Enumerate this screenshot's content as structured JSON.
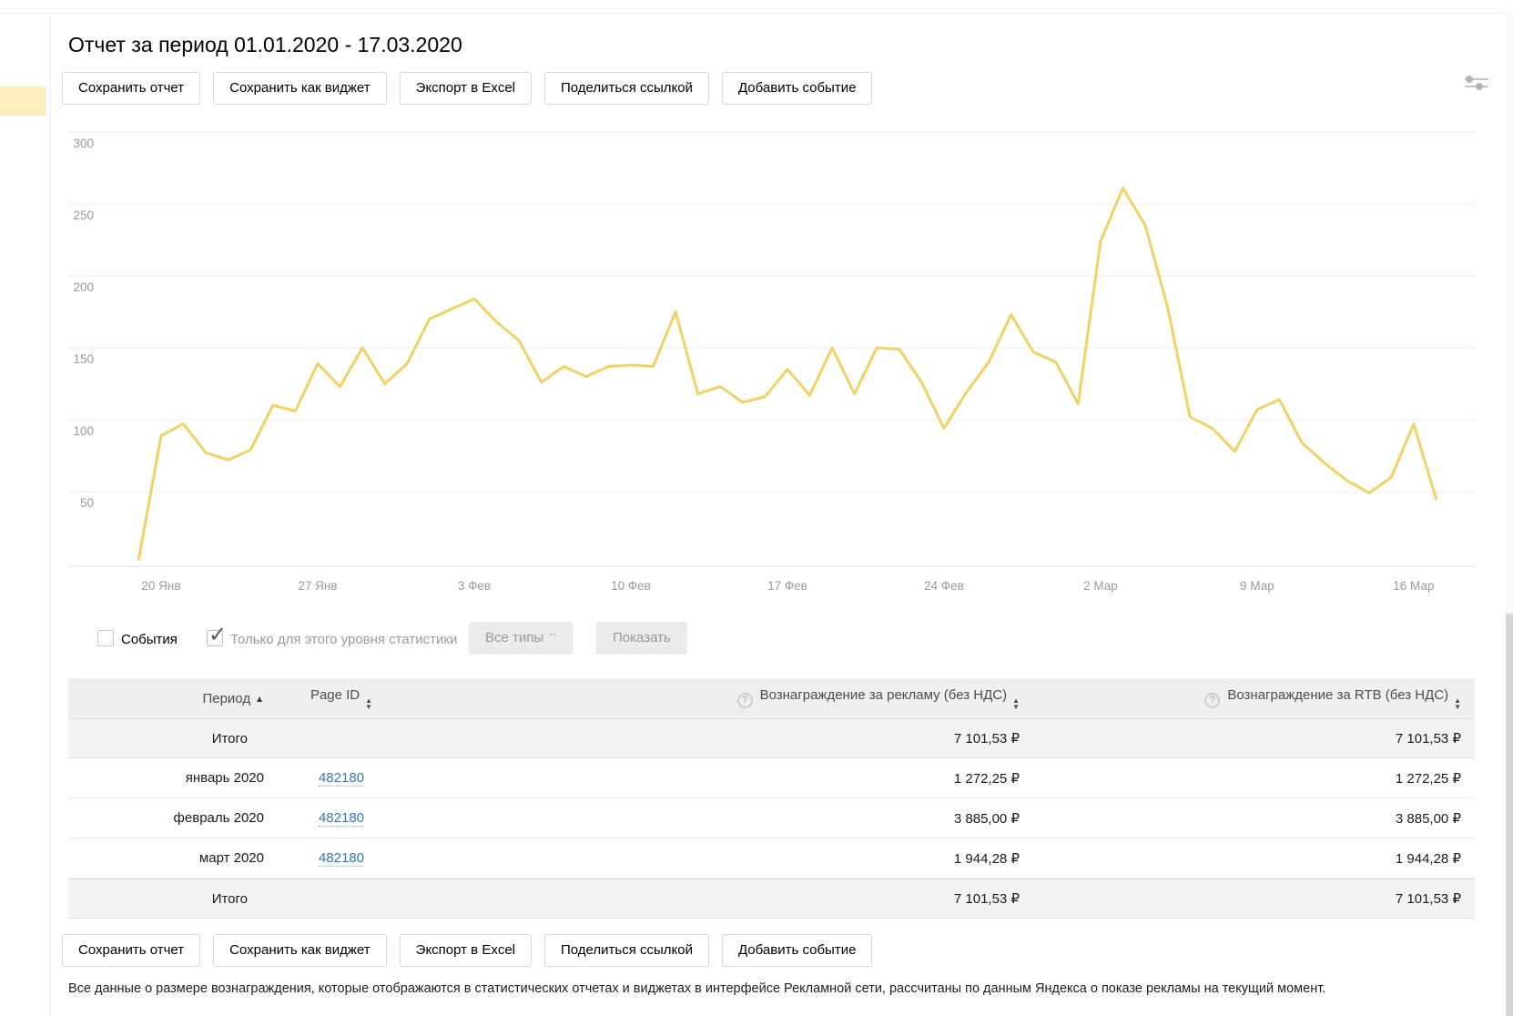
{
  "page": {
    "title": "Отчет за период 01.01.2020 - 17.03.2020"
  },
  "toolbar": {
    "buttons": [
      "Сохранить отчет",
      "Сохранить как виджет",
      "Экспорт в Excel",
      "Поделиться ссылкой",
      "Добавить событие"
    ]
  },
  "filters": {
    "events_label": "События",
    "events_checked": false,
    "level_label": "Только для этого уровня статистики",
    "level_checked": true,
    "type_select_label": "Все типы",
    "show_button_label": "Показать"
  },
  "chart_data": {
    "type": "line",
    "title": "",
    "xlabel": "",
    "ylabel": "",
    "ylim": [
      0,
      300
    ],
    "yticks": [
      50,
      100,
      150,
      200,
      250,
      300
    ],
    "grid": true,
    "legend_position": "none",
    "line_color": "#f2d264",
    "dates": [
      "19.01",
      "20.01",
      "21.01",
      "22.01",
      "23.01",
      "24.01",
      "25.01",
      "26.01",
      "27.01",
      "28.01",
      "29.01",
      "30.01",
      "31.01",
      "01.02",
      "02.02",
      "03.02",
      "04.02",
      "05.02",
      "06.02",
      "07.02",
      "08.02",
      "09.02",
      "10.02",
      "11.02",
      "12.02",
      "13.02",
      "14.02",
      "15.02",
      "16.02",
      "17.02",
      "18.02",
      "19.02",
      "20.02",
      "21.02",
      "22.02",
      "23.02",
      "24.02",
      "25.02",
      "26.02",
      "27.02",
      "28.02",
      "29.02",
      "01.03",
      "02.03",
      "03.03",
      "04.03",
      "05.03",
      "06.03",
      "07.03",
      "08.03",
      "09.03",
      "10.03",
      "11.03",
      "12.03",
      "13.03",
      "14.03",
      "15.03",
      "16.03",
      "17.03"
    ],
    "values": [
      3,
      89,
      97,
      77,
      72,
      79,
      110,
      106,
      139,
      123,
      150,
      125,
      139,
      170,
      177,
      184,
      168,
      155,
      126,
      137,
      130,
      137,
      138,
      137,
      175,
      118,
      123,
      112,
      116,
      135,
      117,
      150,
      118,
      150,
      149,
      126,
      94,
      119,
      140,
      173,
      147,
      140,
      111,
      224,
      261,
      235,
      178,
      102,
      94,
      78,
      107,
      114,
      84,
      70,
      58,
      49,
      60,
      97,
      45
    ],
    "xticks": [
      {
        "i": 1,
        "label": "20 Янв"
      },
      {
        "i": 8,
        "label": "27 Янв"
      },
      {
        "i": 15,
        "label": "3 Фев"
      },
      {
        "i": 22,
        "label": "10 Фев"
      },
      {
        "i": 29,
        "label": "17 Фев"
      },
      {
        "i": 36,
        "label": "24 Фев"
      },
      {
        "i": 43,
        "label": "2 Мар"
      },
      {
        "i": 50,
        "label": "9 Мар"
      },
      {
        "i": 57,
        "label": "16 Мар"
      }
    ]
  },
  "table": {
    "columns": [
      {
        "label": "Период",
        "sort": "asc",
        "help": false
      },
      {
        "label": "Page ID",
        "sort": "both",
        "help": false
      },
      {
        "label": "Вознаграждение за рекламу (без НДС)",
        "sort": "both",
        "help": true
      },
      {
        "label": "Вознаграждение за RTB (без НДС)",
        "sort": "both",
        "help": true
      }
    ],
    "total_label": "Итого",
    "total_ads": "7 101,53 ₽",
    "total_rtb": "7 101,53 ₽",
    "rows": [
      {
        "period": "январь 2020",
        "page_id": "482180",
        "ads": "1 272,25 ₽",
        "rtb": "1 272,25 ₽"
      },
      {
        "period": "февраль 2020",
        "page_id": "482180",
        "ads": "3 885,00 ₽",
        "rtb": "3 885,00 ₽"
      },
      {
        "period": "март 2020",
        "page_id": "482180",
        "ads": "1 944,28 ₽",
        "rtb": "1 944,28 ₽"
      }
    ]
  },
  "footer": {
    "note": "Все данные о размере вознаграждения, которые отображаются в статистических отчетах и виджетах в интерфейсе Рекламной сети, рассчитаны по данным Яндекса о показе рекламы на текущий момент."
  },
  "colors": {
    "accent_line": "#f2d264",
    "link": "#3776bb",
    "rail_highlight": "#fbeebd",
    "grid": "#ededed"
  }
}
